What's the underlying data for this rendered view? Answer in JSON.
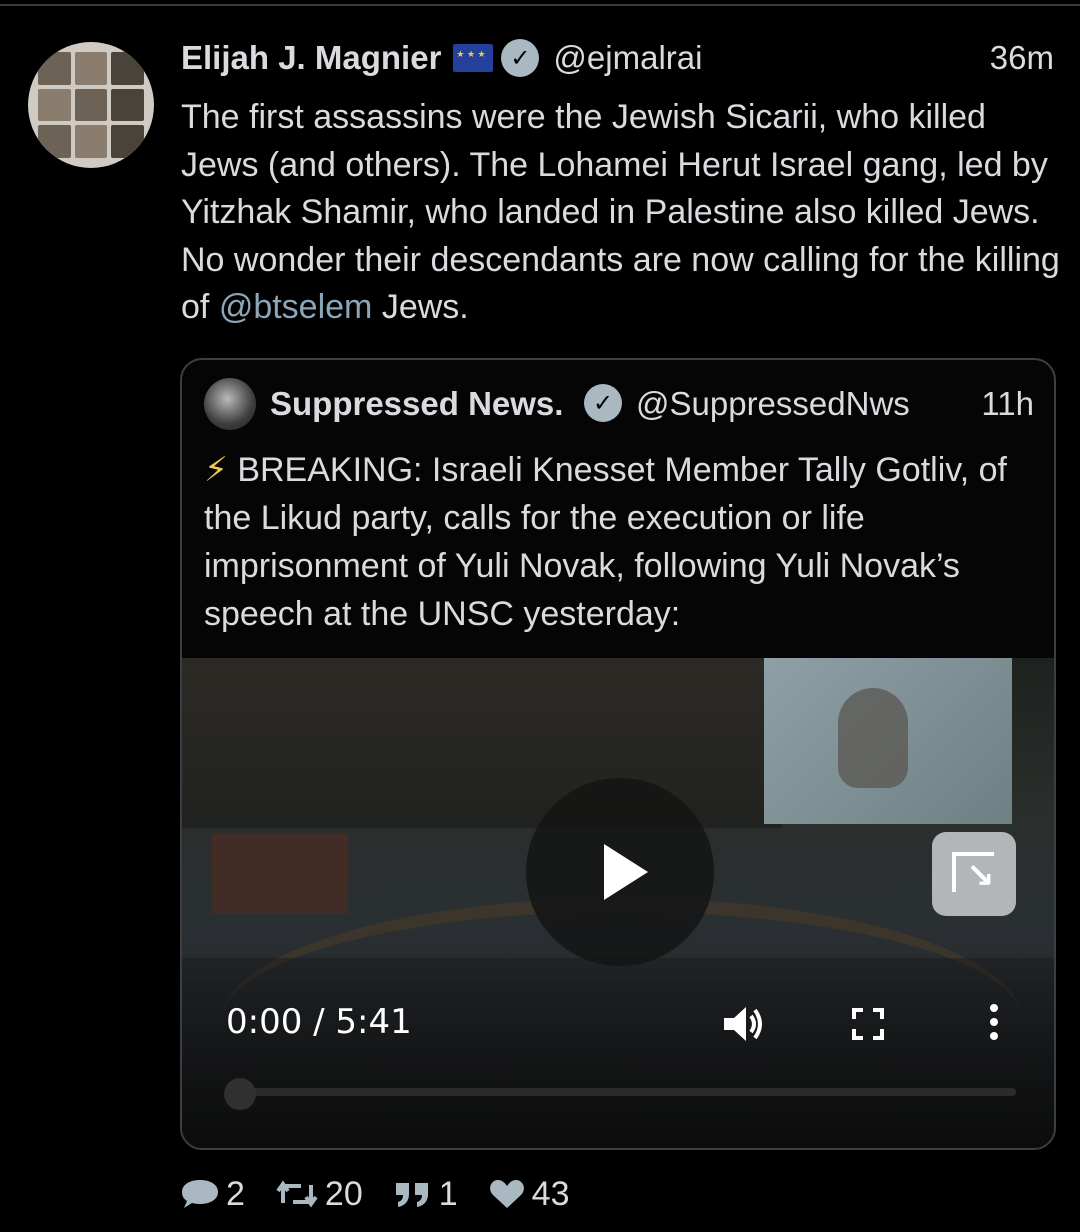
{
  "tweet": {
    "author_name": "Elijah J. Magnier",
    "handle": "@ejmalrai",
    "time": "36m",
    "body_pre": "The first assassins were the Jewish Sicarii, who killed Jews (and others). The Lohamei Herut Israel gang, led by Yitzhak Shamir, who landed in Palestine also killed Jews. No wonder their descendants are now calling for the killing of ",
    "mention": "@btselem",
    "body_post": " Jews."
  },
  "quoted": {
    "author_name": "Suppressed News.",
    "handle": "@SuppressedNws",
    "time": "11h",
    "bolt": "⚡",
    "text": "BREAKING: Israeli Knesset Member Tally Gotliv, of the Likud party, calls for the execution or life imprisonment of Yuli Novak, following Yuli Novak’s speech at the UNSC yesterday:",
    "video": {
      "time_display": "0:00 / 5:41",
      "progress": 0
    }
  },
  "actions": {
    "replies": "2",
    "retweets": "20",
    "quotes": "1",
    "likes": "43"
  },
  "icons": [
    "eu-flag-icon",
    "verified-icon",
    "play-icon",
    "popout-icon",
    "volume-icon",
    "fullscreen-icon",
    "more-icon",
    "reply-icon",
    "retweet-icon",
    "quote-icon",
    "like-icon"
  ],
  "colors": {
    "background": "#000000",
    "text": "#d9dbde",
    "mention": "#8aa6b8",
    "border": "#3b3f44"
  }
}
